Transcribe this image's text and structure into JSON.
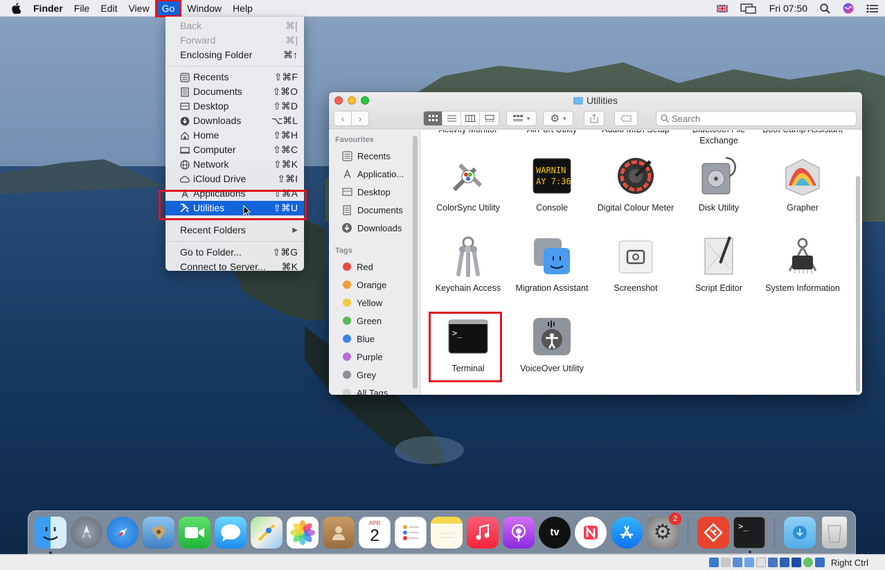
{
  "menubar": {
    "app": "Finder",
    "items": [
      "File",
      "Edit",
      "View",
      "Go",
      "Window",
      "Help"
    ],
    "clock": "Fri 07:50"
  },
  "go_menu": {
    "group1": [
      {
        "label": "Back",
        "shortcut": "⌘[",
        "disabled": true
      },
      {
        "label": "Forward",
        "shortcut": "⌘]",
        "disabled": true
      },
      {
        "label": "Enclosing Folder",
        "shortcut": "⌘↑",
        "disabled": false
      }
    ],
    "group2": [
      {
        "label": "Recents",
        "shortcut": "⇧⌘F",
        "icon": "recents-icon"
      },
      {
        "label": "Documents",
        "shortcut": "⇧⌘O",
        "icon": "documents-icon"
      },
      {
        "label": "Desktop",
        "shortcut": "⇧⌘D",
        "icon": "desktop-icon"
      },
      {
        "label": "Downloads",
        "shortcut": "⌥⌘L",
        "icon": "downloads-icon"
      },
      {
        "label": "Home",
        "shortcut": "⇧⌘H",
        "icon": "home-icon"
      },
      {
        "label": "Computer",
        "shortcut": "⇧⌘C",
        "icon": "computer-icon"
      },
      {
        "label": "Network",
        "shortcut": "⇧⌘K",
        "icon": "network-icon"
      },
      {
        "label": "iCloud Drive",
        "shortcut": "⇧⌘I",
        "icon": "cloud-icon"
      },
      {
        "label": "Applications",
        "shortcut": "⇧⌘A",
        "icon": "applications-icon"
      },
      {
        "label": "Utilities",
        "shortcut": "⇧⌘U",
        "icon": "utilities-icon",
        "selected": true
      }
    ],
    "recent_folders": "Recent Folders",
    "group3": [
      {
        "label": "Go to Folder...",
        "shortcut": "⇧⌘G"
      },
      {
        "label": "Connect to Server...",
        "shortcut": "⌘K"
      }
    ]
  },
  "finder": {
    "title": "Utilities",
    "search_placeholder": "Search",
    "sidebar": {
      "favourites_heading": "Favourites",
      "favourites": [
        {
          "label": "Recents",
          "icon": "recents-icon"
        },
        {
          "label": "Applicatio...",
          "icon": "applications-icon"
        },
        {
          "label": "Desktop",
          "icon": "desktop-icon"
        },
        {
          "label": "Documents",
          "icon": "documents-icon"
        },
        {
          "label": "Downloads",
          "icon": "downloads-icon"
        }
      ],
      "tags_heading": "Tags",
      "tags": [
        {
          "label": "Red",
          "color": "#ec4b48"
        },
        {
          "label": "Orange",
          "color": "#f29a38"
        },
        {
          "label": "Yellow",
          "color": "#f6cb3b"
        },
        {
          "label": "Green",
          "color": "#55bd55"
        },
        {
          "label": "Blue",
          "color": "#3a82f0"
        },
        {
          "label": "Purple",
          "color": "#b66cd6"
        },
        {
          "label": "Grey",
          "color": "#8e8e93"
        },
        {
          "label": "All Tags...",
          "color": "#d0d0d0"
        }
      ]
    },
    "partial_row": [
      "Activity Monitor",
      "AirPort Utility",
      "Audio MIDI Setup",
      "Bluetooth File Exchange",
      "Boot Camp Assistant"
    ],
    "rows": [
      [
        "ColorSync Utility",
        "Console",
        "Digital Colour Meter",
        "Disk Utility",
        "Grapher"
      ],
      [
        "Keychain Access",
        "Migration Assistant",
        "Screenshot",
        "Script Editor",
        "System Information"
      ],
      [
        "Terminal",
        "VoiceOver Utility"
      ]
    ],
    "console_icon_text": "WARNIN\nAY 7:36"
  },
  "dock": {
    "calendar_month": "APR",
    "calendar_day": "2",
    "system_prefs_badge": "2",
    "tv_label": "tv"
  },
  "vbox": {
    "host_key": "Right Ctrl"
  }
}
